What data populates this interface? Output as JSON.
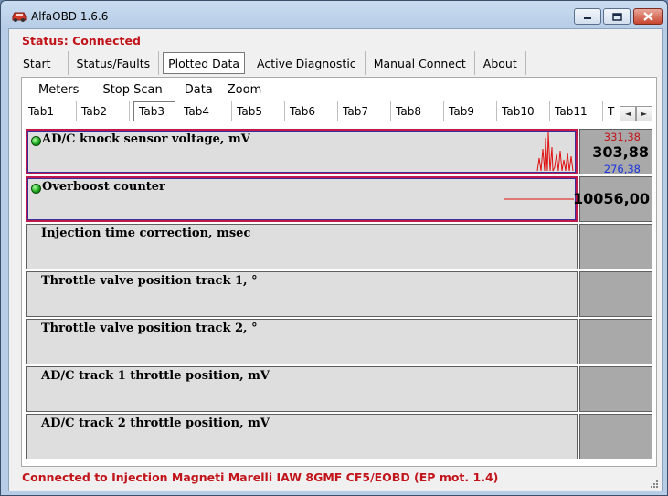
{
  "window": {
    "title": "AlfaOBD 1.6.6"
  },
  "status": "Status: Connected",
  "main_menu": [
    "Start",
    "Status/Faults",
    "Plotted Data",
    "Active Diagnostic",
    "Manual Connect",
    "About"
  ],
  "sub_menu": [
    "Meters",
    "Stop Scan",
    "Data",
    "Zoom"
  ],
  "tabs": [
    "Tab1",
    "Tab2",
    "Tab3",
    "Tab4",
    "Tab5",
    "Tab6",
    "Tab7",
    "Tab8",
    "Tab9",
    "Tab10",
    "Tab11",
    "T"
  ],
  "active_tab": "Tab3",
  "parameters": [
    {
      "label": "AD/C knock sensor voltage, mV",
      "max": "331,38",
      "current": "303,88",
      "min": "276,38"
    },
    {
      "label": "Overboost counter",
      "current": "10056,00"
    },
    {
      "label": "Injection time correction, msec"
    },
    {
      "label": "Throttle valve position track 1, °"
    },
    {
      "label": "Throttle valve position track 2, °"
    },
    {
      "label": "AD/C track 1 throttle position, mV"
    },
    {
      "label": "AD/C track 2 throttle position, mV"
    }
  ],
  "footer": "Connected to Injection Magneti Marelli IAW 8GMF CF5/EOBD (EP mot. 1.4)",
  "colors": {
    "status_red": "#c2141b",
    "min_blue": "#1a33e0",
    "plot_red": "#e01010",
    "led_green": "#18a018"
  }
}
